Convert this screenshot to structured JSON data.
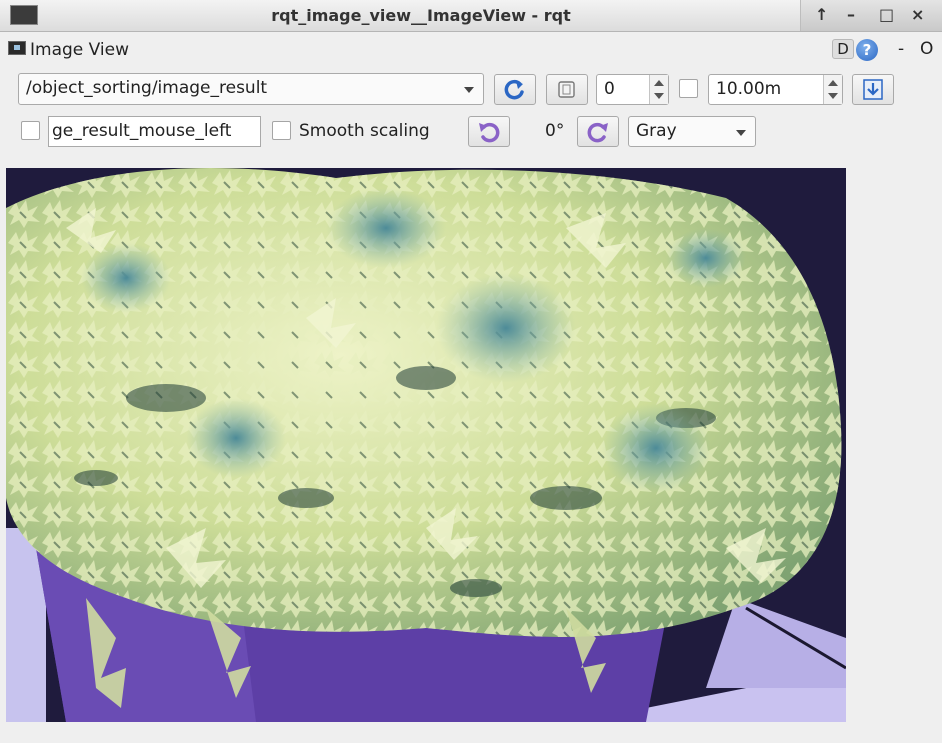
{
  "window": {
    "title": "rqt_image_view__ImageView - rqt",
    "buttons": [
      "↑",
      "–",
      "□",
      "×"
    ]
  },
  "dock": {
    "title": "Image View",
    "d_label": "D",
    "help_label": "?",
    "dash_label": "-",
    "o_label": "O"
  },
  "toolbar": {
    "topic": "/object_sorting/image_result",
    "frame_spin_value": "0",
    "duration_value": "10.00m",
    "mouse_topic_field": "ge_result_mouse_left",
    "smooth_scaling_label": "Smooth scaling",
    "rotation_label": "0°",
    "colormap": "Gray"
  },
  "colors": {
    "accent_blue": "#2b67c4",
    "rotate_purple": "#8a62c7",
    "pot_purple": "#5d3fa6",
    "plant_pale": "#d8e6a8"
  }
}
